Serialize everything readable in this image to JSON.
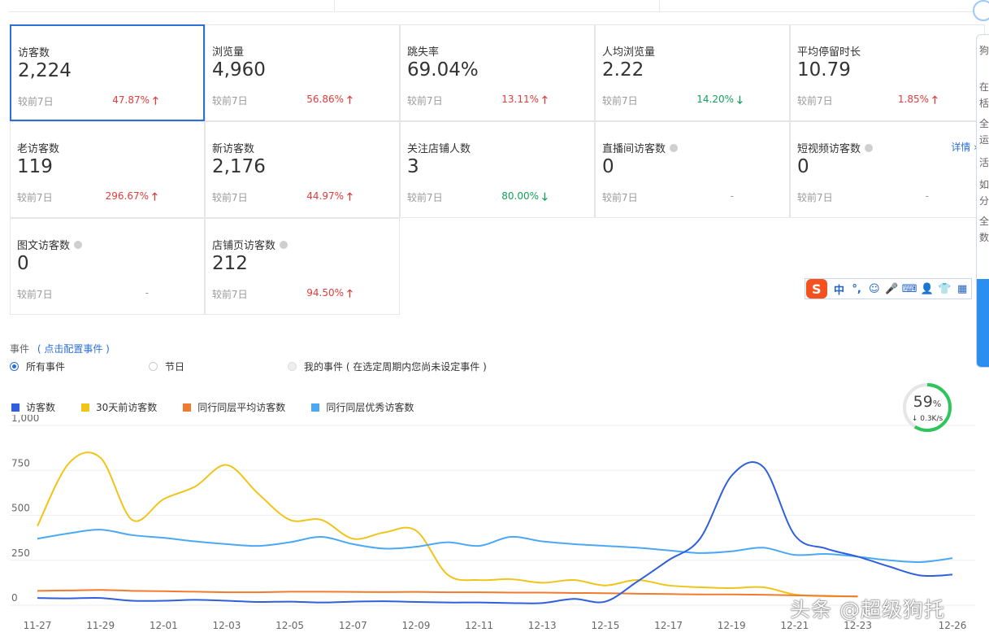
{
  "metrics": [
    {
      "label": "访客数",
      "value": "2,224",
      "compare": "较前7日",
      "pct": "47.87%",
      "dir": "up",
      "active": true
    },
    {
      "label": "浏览量",
      "value": "4,960",
      "compare": "较前7日",
      "pct": "56.86%",
      "dir": "up"
    },
    {
      "label": "跳失率",
      "value": "69.04%",
      "compare": "较前7日",
      "pct": "13.11%",
      "dir": "up"
    },
    {
      "label": "人均浏览量",
      "value": "2.22",
      "compare": "较前7日",
      "pct": "14.20%",
      "dir": "down"
    },
    {
      "label": "平均停留时长",
      "value": "10.79",
      "compare": "较前7日",
      "pct": "1.85%",
      "dir": "up"
    },
    {
      "label": "老访客数",
      "value": "119",
      "compare": "较前7日",
      "pct": "296.67%",
      "dir": "up"
    },
    {
      "label": "新访客数",
      "value": "2,176",
      "compare": "较前7日",
      "pct": "44.97%",
      "dir": "up"
    },
    {
      "label": "关注店铺人数",
      "value": "3",
      "compare": "较前7日",
      "pct": "80.00%",
      "dir": "down"
    },
    {
      "label": "直播间访客数",
      "value": "0",
      "compare": "较前7日",
      "pct": "-",
      "dir": "flat",
      "info": true
    },
    {
      "label": "短视频访客数",
      "value": "0",
      "compare": "较前7日",
      "pct": "-",
      "dir": "flat",
      "info": true,
      "detail": "详情 ›"
    },
    {
      "label": "图文访客数",
      "value": "0",
      "compare": "较前7日",
      "pct": "-",
      "dir": "flat",
      "info": true
    },
    {
      "label": "店铺页访客数",
      "value": "212",
      "compare": "较前7日",
      "pct": "94.50%",
      "dir": "up",
      "info": true
    }
  ],
  "ime": {
    "logo": "S",
    "items": [
      "中",
      "°,",
      "☺",
      "🎤",
      "⌨",
      "👤",
      "👕",
      "▦"
    ]
  },
  "side_panel": {
    "rows": [
      "狗",
      "在",
      "栝",
      "全",
      "运",
      "活",
      "如",
      "分",
      "全",
      "数"
    ]
  },
  "events": {
    "title": "事件",
    "config_link": "( 点击配置事件 )",
    "options": [
      {
        "label": "所有事件",
        "state": "on"
      },
      {
        "label": "节日",
        "state": "off"
      },
      {
        "label": "我的事件 ( 在选定周期内您尚未设定事件 )",
        "state": "disabled"
      }
    ]
  },
  "speed_widget": {
    "percent": "59",
    "unit": "%",
    "rate": "↓ 0.3K/s",
    "fraction": 0.59
  },
  "watermark": "头条 @超级狗托",
  "colors": {
    "accent": "#2c6fd6",
    "up": "#e23b3b",
    "down": "#12a159"
  },
  "chart_data": {
    "type": "line",
    "x": [
      "11-27",
      "11-28",
      "11-29",
      "11-30",
      "12-01",
      "12-02",
      "12-03",
      "12-04",
      "12-05",
      "12-06",
      "12-07",
      "12-08",
      "12-09",
      "12-10",
      "12-11",
      "12-12",
      "12-13",
      "12-14",
      "12-15",
      "12-16",
      "12-17",
      "12-18",
      "12-19",
      "12-20",
      "12-21",
      "12-22",
      "12-23",
      "12-24",
      "12-25",
      "12-26"
    ],
    "x_tick_labels": [
      "11-27",
      "11-29",
      "12-01",
      "12-03",
      "12-05",
      "12-07",
      "12-09",
      "12-11",
      "12-13",
      "12-15",
      "12-17",
      "12-19",
      "12-21",
      "12-23",
      "12-26"
    ],
    "ylim": [
      0,
      1000
    ],
    "yticks": [
      "1,000",
      "750",
      "500",
      "250",
      "0"
    ],
    "grid": true,
    "legend_position": "top-left",
    "series": [
      {
        "name": "访客数",
        "color": "#2f5fdc",
        "values": [
          40,
          38,
          40,
          25,
          25,
          30,
          25,
          18,
          20,
          15,
          20,
          22,
          18,
          15,
          15,
          12,
          12,
          35,
          20,
          130,
          250,
          370,
          720,
          770,
          390,
          315,
          270,
          215,
          165,
          170
        ]
      },
      {
        "name": "30天前访客数",
        "color": "#f0c419",
        "values": [
          440,
          790,
          820,
          475,
          590,
          660,
          780,
          620,
          475,
          475,
          370,
          405,
          415,
          170,
          140,
          145,
          125,
          140,
          110,
          140,
          110,
          100,
          95,
          100,
          60,
          50,
          50,
          null,
          null,
          null
        ]
      },
      {
        "name": "同行同层平均访客数",
        "color": "#f07b2e",
        "values": [
          80,
          82,
          85,
          80,
          78,
          75,
          72,
          72,
          75,
          75,
          74,
          73,
          74,
          72,
          72,
          70,
          70,
          68,
          67,
          64,
          62,
          60,
          60,
          58,
          55,
          52,
          48,
          null,
          null,
          null
        ]
      },
      {
        "name": "同行同层优秀访客数",
        "color": "#4aa8f5",
        "values": [
          370,
          400,
          420,
          390,
          375,
          355,
          340,
          330,
          350,
          380,
          340,
          315,
          325,
          350,
          330,
          380,
          355,
          340,
          330,
          320,
          305,
          290,
          300,
          320,
          280,
          285,
          270,
          250,
          240,
          262
        ]
      }
    ]
  }
}
